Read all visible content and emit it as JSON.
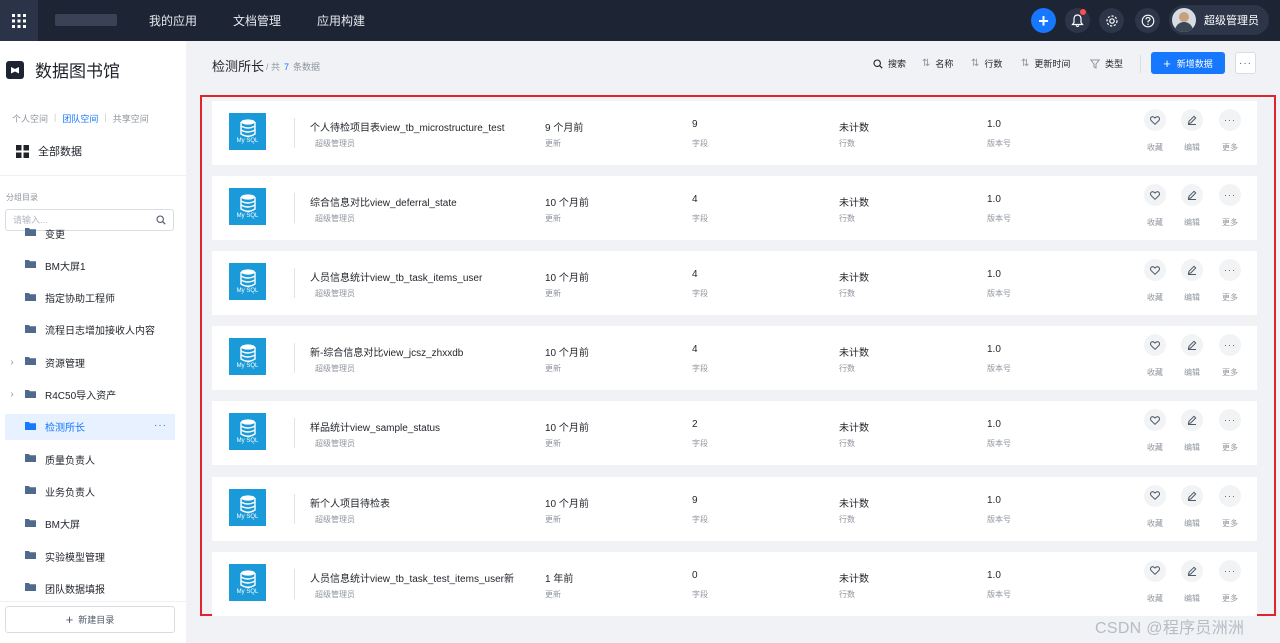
{
  "topbar": {
    "nav": [
      "我的应用",
      "文档管理",
      "应用构建"
    ],
    "user_name": "超级管理员"
  },
  "sidebar": {
    "title": "数据图书馆",
    "spaces": [
      "个人空间",
      "团队空间",
      "共享空间"
    ],
    "active_space": "团队空间",
    "all_data": "全部数据",
    "group_label": "分组目录",
    "search_placeholder": "请输入...",
    "tree": [
      {
        "label": "变更",
        "caret": false,
        "active": false
      },
      {
        "label": "BM大屏1",
        "caret": false,
        "active": false
      },
      {
        "label": "指定协助工程师",
        "caret": false,
        "active": false
      },
      {
        "label": "流程日志增加接收人内容",
        "caret": false,
        "active": false
      },
      {
        "label": "资源管理",
        "caret": true,
        "active": false
      },
      {
        "label": "R4C50导入资产",
        "caret": true,
        "active": false
      },
      {
        "label": "检测所长",
        "caret": false,
        "active": true
      },
      {
        "label": "质量负责人",
        "caret": false,
        "active": false
      },
      {
        "label": "业务负责人",
        "caret": false,
        "active": false
      },
      {
        "label": "BM大屏",
        "caret": false,
        "active": false
      },
      {
        "label": "实验模型管理",
        "caret": false,
        "active": false
      },
      {
        "label": "团队数据填报",
        "caret": false,
        "active": false
      }
    ],
    "new_dir": "新建目录"
  },
  "header": {
    "title": "检测所长",
    "count_prefix": "/ 共",
    "count": "7",
    "count_suffix": "条数据",
    "search": "搜索",
    "sort_name": "名称",
    "sort_rows": "行数",
    "sort_updated": "更新时间",
    "filter_type": "类型",
    "new_data": "新增数据"
  },
  "labels": {
    "owner": "超级管理员",
    "updated": "更新",
    "fields": "字段",
    "rows": "行数",
    "version": "版本号",
    "favorite": "收藏",
    "edit": "编辑",
    "more": "更多",
    "db_badge": "My SQL"
  },
  "items": [
    {
      "name": "个人待检项目表view_tb_microstructure_test",
      "updated": "9 个月前",
      "fields": "9",
      "rows": "未计数",
      "version": "1.0"
    },
    {
      "name": "综合信息对比view_deferral_state",
      "updated": "10 个月前",
      "fields": "4",
      "rows": "未计数",
      "version": "1.0"
    },
    {
      "name": "人员信息统计view_tb_task_items_user",
      "updated": "10 个月前",
      "fields": "4",
      "rows": "未计数",
      "version": "1.0"
    },
    {
      "name": "新-综合信息对比view_jcsz_zhxxdb",
      "updated": "10 个月前",
      "fields": "4",
      "rows": "未计数",
      "version": "1.0"
    },
    {
      "name": "样品统计view_sample_status",
      "updated": "10 个月前",
      "fields": "2",
      "rows": "未计数",
      "version": "1.0"
    },
    {
      "name": "新个人项目待检表",
      "updated": "10 个月前",
      "fields": "9",
      "rows": "未计数",
      "version": "1.0"
    },
    {
      "name": "人员信息统计view_tb_task_test_items_user新",
      "updated": "1 年前",
      "fields": "0",
      "rows": "未计数",
      "version": "1.0"
    }
  ],
  "watermark": "CSDN @程序员洲洲",
  "colors": {
    "accent": "#1677ff",
    "topbar": "#1d2434",
    "db_icon": "#1a9ad8",
    "highlight_border": "#e0242b"
  }
}
